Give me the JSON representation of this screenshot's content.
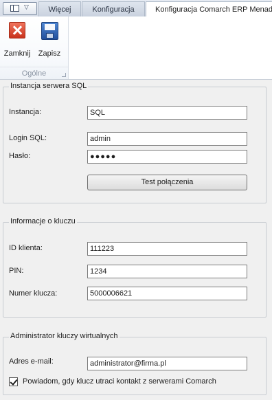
{
  "tabs": {
    "more": "Więcej",
    "configuration": "Konfiguracja",
    "active": "Konfiguracja Comarch ERP Menadżer Kluczy"
  },
  "ribbon": {
    "close_label": "Zamknij",
    "save_label": "Zapisz",
    "group_label": "Ogólne",
    "icons": {
      "close": "close-icon",
      "save": "save-icon",
      "quick_access": "window-layout-icon"
    }
  },
  "sql_group": {
    "title": "Instancja serwera SQL",
    "instance_label": "Instancja:",
    "instance_value": "SQL",
    "login_label": "Login SQL:",
    "login_value": "admin",
    "password_label": "Hasło:",
    "password_mask": "●●●●●",
    "test_button": "Test połączenia"
  },
  "key_group": {
    "title": "Informacje o kluczu",
    "client_id_label": "ID klienta:",
    "client_id_value": "111223",
    "pin_label": "PIN:",
    "pin_value": "1234",
    "key_number_label": "Numer klucza:",
    "key_number_value": "5000006621"
  },
  "admin_group": {
    "title": "Administrator kluczy wirtualnych",
    "email_label": "Adres e-mail:",
    "email_value": "administrator@firma.pl",
    "notify_checked": true,
    "notify_label": "Powiadom, gdy klucz utraci kontakt z serwerami Comarch"
  },
  "colors": {
    "ribbon_bg": "#ffffff",
    "window_bg": "#f0f0f0",
    "close_icon": "#d2402a",
    "save_icon": "#2f63b5"
  }
}
